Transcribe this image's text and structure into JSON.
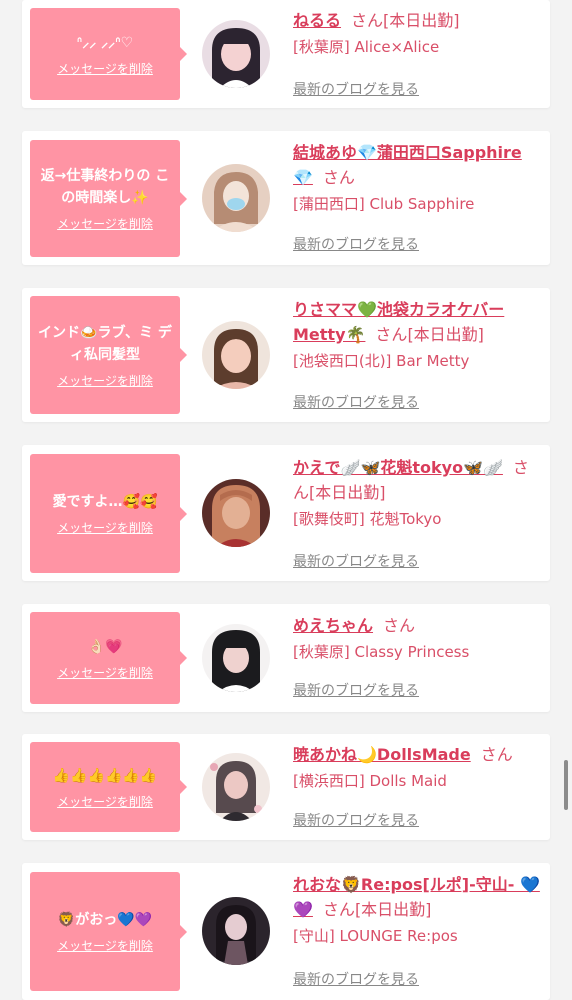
{
  "common": {
    "delete_label": "メッセージを削除",
    "blog_label": "最新のブログを見る",
    "san_label": "さん"
  },
  "cards": [
    {
      "message": "ᐢ⸝⸝ ⸝⸝ᐢ♡",
      "name": "ねるる",
      "status": "[本日出勤]",
      "shop": "[秋葉原] Alice×Alice",
      "avatar_colors": [
        "#e9dde4",
        "#2c2430",
        "#f4d2d2"
      ]
    },
    {
      "message": "返→仕事終わりの この時間楽し✨",
      "name": "結城あゆ💎蒲田西口Sapphire 💎",
      "status": "",
      "shop": "[蒲田西口] Club Sapphire",
      "avatar_colors": [
        "#e6d0c2",
        "#b68c74",
        "#f3e4d9"
      ]
    },
    {
      "message": "インド🍛ラブ、ミ ディ私同髪型",
      "name": "りさママ💚池袋カラオケバー Metty🌴",
      "status": "[本日出勤]",
      "shop": "[池袋西口(北)] Bar Metty",
      "avatar_colors": [
        "#efe4dc",
        "#5d3d2d",
        "#f4cdbd"
      ]
    },
    {
      "message": "愛ですよ…🥰🥰",
      "name": "かえで🪽🦋花魁tokyo🦋🪽",
      "status": "[本日出勤]",
      "shop": "[歌舞伎町] 花魁Tokyo",
      "avatar_colors": [
        "#5a2d28",
        "#c7805f",
        "#e3b094"
      ]
    },
    {
      "message": "👌🏻💗",
      "name": "めえちゃん",
      "status": "",
      "shop": "[秋葉原] Classy Princess",
      "avatar_colors": [
        "#f4f2f2",
        "#1b1b1e",
        "#efd2cf"
      ]
    },
    {
      "message": "👍👍👍👍👍👍",
      "name": "暁あかね🌙DollsMade",
      "status": "",
      "shop": "[横浜西口] Dolls Maid",
      "avatar_colors": [
        "#f1e8e4",
        "#574a4e",
        "#ecc8c4"
      ]
    },
    {
      "message": "🦁がおっ💙💜",
      "name": "れおな🦁Re:pos[ルポ]-守山- 💙💜",
      "status": "[本日出勤]",
      "shop": "[守山] LOUNGE Re:pos",
      "avatar_colors": [
        "#2b242c",
        "#6d5561",
        "#e5ccd1"
      ]
    }
  ]
}
